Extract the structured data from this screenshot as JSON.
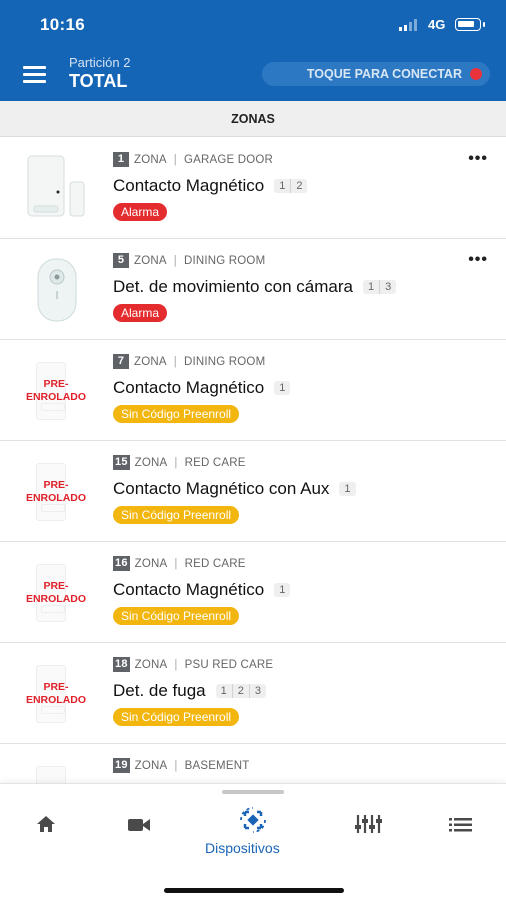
{
  "status_bar": {
    "time": "10:16",
    "network": "4G"
  },
  "header": {
    "partition": "Partición 2",
    "mode": "TOTAL",
    "connect_label": "TOQUE PARA CONECTAR"
  },
  "section_title": "ZONAS",
  "zone_word": "ZONA",
  "zones": [
    {
      "number": "1",
      "location": "GARAGE DOOR",
      "name": "Contacto Magnético",
      "chips": [
        "1",
        "2"
      ],
      "status": "Alarma",
      "status_color": "#e42b2e",
      "thumb": "door-contact-sensor-image",
      "more": "•••"
    },
    {
      "number": "5",
      "location": "DINING ROOM",
      "name": "Det. de movimiento con cámara",
      "chips": [
        "1",
        "3"
      ],
      "status": "Alarma",
      "status_color": "#e42b2e",
      "thumb": "motion-camera-sensor-image",
      "more": "•••"
    },
    {
      "number": "7",
      "location": "DINING ROOM",
      "name": "Contacto Magnético",
      "chips": [
        "1"
      ],
      "status": "Sin Código Preenroll",
      "status_color": "#f2b60f",
      "thumb_label": [
        "PRE-",
        "ENROLADO"
      ]
    },
    {
      "number": "15",
      "location": "RED CARE",
      "name": "Contacto Magnético con Aux",
      "chips": [
        "1"
      ],
      "status": "Sin Código Preenroll",
      "status_color": "#f2b60f",
      "thumb_label": [
        "PRE-",
        "ENROLADO"
      ]
    },
    {
      "number": "16",
      "location": "RED CARE",
      "name": "Contacto Magnético",
      "chips": [
        "1"
      ],
      "status": "Sin Código Preenroll",
      "status_color": "#f2b60f",
      "thumb_label": [
        "PRE-",
        "ENROLADO"
      ]
    },
    {
      "number": "18",
      "location": "PSU RED CARE",
      "name": "Det. de fuga",
      "chips": [
        "1",
        "2",
        "3"
      ],
      "status": "Sin Código Preenroll",
      "status_color": "#f2b60f",
      "thumb_label": [
        "PRE-",
        "ENROLADO"
      ]
    },
    {
      "number": "19",
      "location": "BASEMENT"
    }
  ],
  "bottom_nav": {
    "items": [
      "home-icon",
      "camera-icon",
      "devices-icon",
      "sliders-icon",
      "list-icon"
    ],
    "active_label": "Dispositivos",
    "active_color": "#1a64b8"
  }
}
